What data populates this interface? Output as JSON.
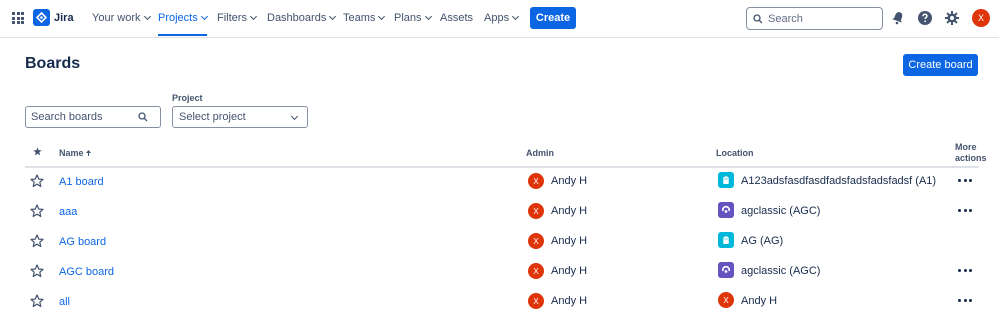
{
  "app": {
    "name": "Jira"
  },
  "nav": {
    "items": [
      {
        "label": "Your work",
        "chevron": true
      },
      {
        "label": "Projects",
        "chevron": true,
        "active": true
      },
      {
        "label": "Filters",
        "chevron": true
      },
      {
        "label": "Dashboards",
        "chevron": true
      },
      {
        "label": "Teams",
        "chevron": true
      },
      {
        "label": "Plans",
        "chevron": true
      },
      {
        "label": "Assets",
        "chevron": false
      },
      {
        "label": "Apps",
        "chevron": true
      }
    ],
    "create_label": "Create",
    "search_placeholder": "Search",
    "user_initial": "X"
  },
  "page": {
    "title": "Boards",
    "create_board_label": "Create board",
    "search_placeholder": "Search boards",
    "project_label": "Project",
    "project_select_value": "Select project"
  },
  "table": {
    "headers": {
      "name": "Name",
      "admin": "Admin",
      "location": "Location",
      "more_1": "More",
      "more_2": "actions"
    },
    "rows": [
      {
        "name": "A1 board",
        "admin_initial": "X",
        "admin": "Andy H",
        "location_icon": "teal-project-icon",
        "location": "A123adsfasdfasdfadsfadsfadsfadsf (A1)",
        "more": true
      },
      {
        "name": "aaa",
        "admin_initial": "X",
        "admin": "Andy H",
        "location_icon": "purple-project-icon",
        "location": "agclassic (AGC)",
        "more": true
      },
      {
        "name": "AG board",
        "admin_initial": "X",
        "admin": "Andy H",
        "location_icon": "teal-project-icon",
        "location": "AG (AG)",
        "more": false
      },
      {
        "name": "AGC board",
        "admin_initial": "X",
        "admin": "Andy H",
        "location_icon": "purple-project-icon",
        "location": "agclassic (AGC)",
        "more": true
      },
      {
        "name": "all",
        "admin_initial": "X",
        "admin": "Andy H",
        "location_icon": "user-avatar-icon",
        "location_initial": "X",
        "location": "Andy H",
        "more": true
      }
    ]
  },
  "colors": {
    "brand": "#0c66e4",
    "avatar": "#de350b",
    "teal": "#00b8d9",
    "purple": "#6554c0"
  }
}
